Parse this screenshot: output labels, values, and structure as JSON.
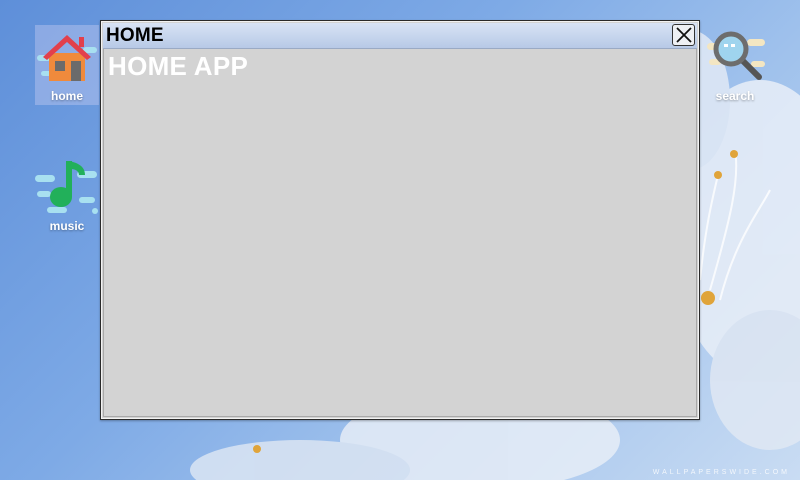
{
  "desktop": {
    "icons": [
      {
        "label": "home",
        "icon": "house-icon"
      },
      {
        "label": "music",
        "icon": "music-note-icon"
      },
      {
        "label": "search",
        "icon": "magnifier-icon"
      }
    ]
  },
  "window": {
    "title": "HOME",
    "content_heading": "HOME APP"
  },
  "wallpaper": {
    "watermark": "WALLPAPERSWIDE.COM"
  },
  "colors": {
    "window_bg": "#d3d3d3",
    "titlebar": "#c7d6ee",
    "desktop_blue": "#6f9fe0"
  }
}
